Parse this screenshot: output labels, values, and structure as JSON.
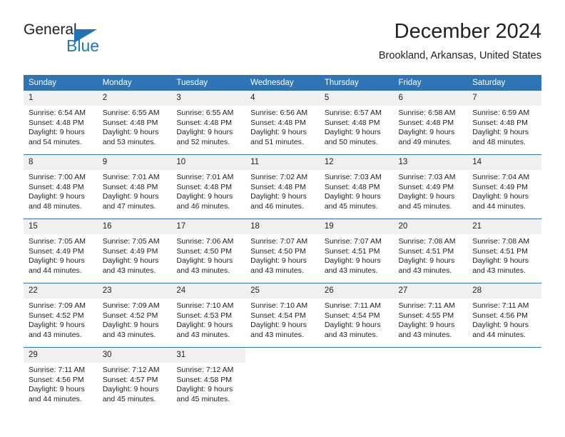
{
  "brand": {
    "name_top": "General",
    "name_bottom": "Blue",
    "triangle_color": "#2372b8",
    "blue_color": "#1f76c4"
  },
  "header": {
    "month_title": "December 2024",
    "location": "Brookland, Arkansas, United States"
  },
  "theme": {
    "header_bg": "#2f75b5",
    "header_text": "#ffffff",
    "daynum_bg": "#f0f0f0",
    "text": "#222222"
  },
  "calendar": {
    "weekday_headers": [
      "Sunday",
      "Monday",
      "Tuesday",
      "Wednesday",
      "Thursday",
      "Friday",
      "Saturday"
    ],
    "weeks": [
      [
        {
          "day": "1",
          "sunrise": "Sunrise: 6:54 AM",
          "sunset": "Sunset: 4:48 PM",
          "daylight": "Daylight: 9 hours and 54 minutes."
        },
        {
          "day": "2",
          "sunrise": "Sunrise: 6:55 AM",
          "sunset": "Sunset: 4:48 PM",
          "daylight": "Daylight: 9 hours and 53 minutes."
        },
        {
          "day": "3",
          "sunrise": "Sunrise: 6:55 AM",
          "sunset": "Sunset: 4:48 PM",
          "daylight": "Daylight: 9 hours and 52 minutes."
        },
        {
          "day": "4",
          "sunrise": "Sunrise: 6:56 AM",
          "sunset": "Sunset: 4:48 PM",
          "daylight": "Daylight: 9 hours and 51 minutes."
        },
        {
          "day": "5",
          "sunrise": "Sunrise: 6:57 AM",
          "sunset": "Sunset: 4:48 PM",
          "daylight": "Daylight: 9 hours and 50 minutes."
        },
        {
          "day": "6",
          "sunrise": "Sunrise: 6:58 AM",
          "sunset": "Sunset: 4:48 PM",
          "daylight": "Daylight: 9 hours and 49 minutes."
        },
        {
          "day": "7",
          "sunrise": "Sunrise: 6:59 AM",
          "sunset": "Sunset: 4:48 PM",
          "daylight": "Daylight: 9 hours and 48 minutes."
        }
      ],
      [
        {
          "day": "8",
          "sunrise": "Sunrise: 7:00 AM",
          "sunset": "Sunset: 4:48 PM",
          "daylight": "Daylight: 9 hours and 48 minutes."
        },
        {
          "day": "9",
          "sunrise": "Sunrise: 7:01 AM",
          "sunset": "Sunset: 4:48 PM",
          "daylight": "Daylight: 9 hours and 47 minutes."
        },
        {
          "day": "10",
          "sunrise": "Sunrise: 7:01 AM",
          "sunset": "Sunset: 4:48 PM",
          "daylight": "Daylight: 9 hours and 46 minutes."
        },
        {
          "day": "11",
          "sunrise": "Sunrise: 7:02 AM",
          "sunset": "Sunset: 4:48 PM",
          "daylight": "Daylight: 9 hours and 46 minutes."
        },
        {
          "day": "12",
          "sunrise": "Sunrise: 7:03 AM",
          "sunset": "Sunset: 4:48 PM",
          "daylight": "Daylight: 9 hours and 45 minutes."
        },
        {
          "day": "13",
          "sunrise": "Sunrise: 7:03 AM",
          "sunset": "Sunset: 4:49 PM",
          "daylight": "Daylight: 9 hours and 45 minutes."
        },
        {
          "day": "14",
          "sunrise": "Sunrise: 7:04 AM",
          "sunset": "Sunset: 4:49 PM",
          "daylight": "Daylight: 9 hours and 44 minutes."
        }
      ],
      [
        {
          "day": "15",
          "sunrise": "Sunrise: 7:05 AM",
          "sunset": "Sunset: 4:49 PM",
          "daylight": "Daylight: 9 hours and 44 minutes."
        },
        {
          "day": "16",
          "sunrise": "Sunrise: 7:05 AM",
          "sunset": "Sunset: 4:49 PM",
          "daylight": "Daylight: 9 hours and 43 minutes."
        },
        {
          "day": "17",
          "sunrise": "Sunrise: 7:06 AM",
          "sunset": "Sunset: 4:50 PM",
          "daylight": "Daylight: 9 hours and 43 minutes."
        },
        {
          "day": "18",
          "sunrise": "Sunrise: 7:07 AM",
          "sunset": "Sunset: 4:50 PM",
          "daylight": "Daylight: 9 hours and 43 minutes."
        },
        {
          "day": "19",
          "sunrise": "Sunrise: 7:07 AM",
          "sunset": "Sunset: 4:51 PM",
          "daylight": "Daylight: 9 hours and 43 minutes."
        },
        {
          "day": "20",
          "sunrise": "Sunrise: 7:08 AM",
          "sunset": "Sunset: 4:51 PM",
          "daylight": "Daylight: 9 hours and 43 minutes."
        },
        {
          "day": "21",
          "sunrise": "Sunrise: 7:08 AM",
          "sunset": "Sunset: 4:51 PM",
          "daylight": "Daylight: 9 hours and 43 minutes."
        }
      ],
      [
        {
          "day": "22",
          "sunrise": "Sunrise: 7:09 AM",
          "sunset": "Sunset: 4:52 PM",
          "daylight": "Daylight: 9 hours and 43 minutes."
        },
        {
          "day": "23",
          "sunrise": "Sunrise: 7:09 AM",
          "sunset": "Sunset: 4:52 PM",
          "daylight": "Daylight: 9 hours and 43 minutes."
        },
        {
          "day": "24",
          "sunrise": "Sunrise: 7:10 AM",
          "sunset": "Sunset: 4:53 PM",
          "daylight": "Daylight: 9 hours and 43 minutes."
        },
        {
          "day": "25",
          "sunrise": "Sunrise: 7:10 AM",
          "sunset": "Sunset: 4:54 PM",
          "daylight": "Daylight: 9 hours and 43 minutes."
        },
        {
          "day": "26",
          "sunrise": "Sunrise: 7:11 AM",
          "sunset": "Sunset: 4:54 PM",
          "daylight": "Daylight: 9 hours and 43 minutes."
        },
        {
          "day": "27",
          "sunrise": "Sunrise: 7:11 AM",
          "sunset": "Sunset: 4:55 PM",
          "daylight": "Daylight: 9 hours and 43 minutes."
        },
        {
          "day": "28",
          "sunrise": "Sunrise: 7:11 AM",
          "sunset": "Sunset: 4:56 PM",
          "daylight": "Daylight: 9 hours and 44 minutes."
        }
      ],
      [
        {
          "day": "29",
          "sunrise": "Sunrise: 7:11 AM",
          "sunset": "Sunset: 4:56 PM",
          "daylight": "Daylight: 9 hours and 44 minutes."
        },
        {
          "day": "30",
          "sunrise": "Sunrise: 7:12 AM",
          "sunset": "Sunset: 4:57 PM",
          "daylight": "Daylight: 9 hours and 45 minutes."
        },
        {
          "day": "31",
          "sunrise": "Sunrise: 7:12 AM",
          "sunset": "Sunset: 4:58 PM",
          "daylight": "Daylight: 9 hours and 45 minutes."
        },
        {
          "day": "",
          "sunrise": "",
          "sunset": "",
          "daylight": ""
        },
        {
          "day": "",
          "sunrise": "",
          "sunset": "",
          "daylight": ""
        },
        {
          "day": "",
          "sunrise": "",
          "sunset": "",
          "daylight": ""
        },
        {
          "day": "",
          "sunrise": "",
          "sunset": "",
          "daylight": ""
        }
      ]
    ]
  }
}
